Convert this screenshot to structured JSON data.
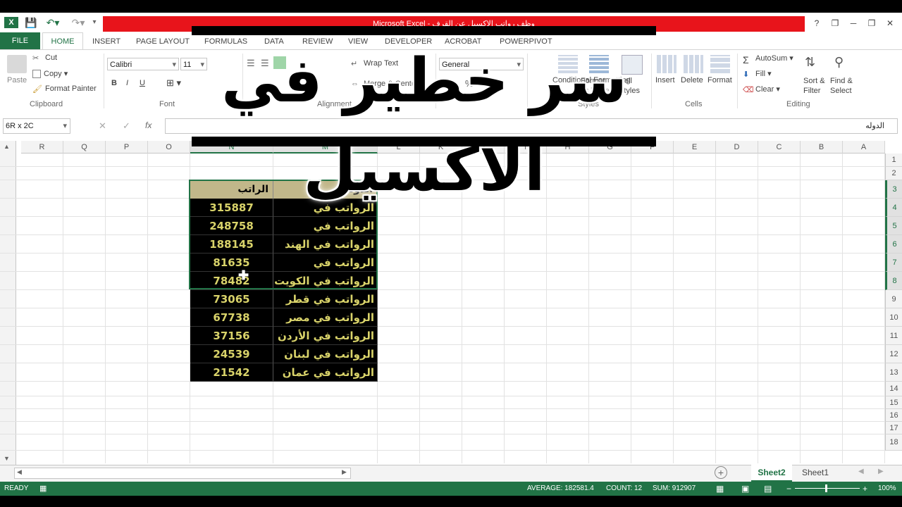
{
  "window": {
    "title": "Microsoft Excel - وظف رواتب الاكسيل عن القرف",
    "controls": [
      "?",
      "❐",
      "─",
      "❐",
      "✕"
    ]
  },
  "ribbon_tabs": [
    "FILE",
    "HOME",
    "INSERT",
    "PAGE LAYOUT",
    "FORMULAS",
    "DATA",
    "REVIEW",
    "VIEW",
    "DEVELOPER",
    "ACROBAT",
    "POWERPIVOT"
  ],
  "clipboard": {
    "paste": "Paste",
    "cut": "Cut",
    "copy": "Copy",
    "format_painter": "Format Painter",
    "label": "Clipboard"
  },
  "font": {
    "name": "Calibri",
    "size": "11",
    "bold": "B",
    "italic": "I",
    "underline": "U",
    "label": "Font"
  },
  "alignment": {
    "wrap_text": "Wrap Text",
    "merge_center": "Merge & Center",
    "label": "Alignment"
  },
  "number": {
    "format": "General",
    "currency": "$",
    "percent": "%"
  },
  "styles": {
    "conditional": "Conditional Formatting",
    "format_as_table": "Format as Table",
    "cell_styles": "Cell Styles",
    "label": "Styles"
  },
  "cells": {
    "insert": "Insert",
    "delete": "Delete",
    "format": "Format",
    "label": "Cells"
  },
  "editing": {
    "autosum": "AutoSum",
    "fill": "Fill",
    "clear": "Clear",
    "sort_filter": "Sort & Filter",
    "find_select": "Find & Select",
    "label": "Editing"
  },
  "formula_bar": {
    "name_box": "6R x 2C",
    "fx": "fx",
    "content": "الدوله"
  },
  "columns": [
    "R",
    "Q",
    "P",
    "O",
    "N",
    "M",
    "L",
    "K",
    "J",
    "I",
    "H",
    "G",
    "F",
    "E",
    "D",
    "C",
    "B",
    "A"
  ],
  "rows": [
    "1",
    "2",
    "3",
    "4",
    "5",
    "6",
    "7",
    "8",
    "9",
    "10",
    "11",
    "12",
    "13",
    "14",
    "15",
    "16",
    "17",
    "18"
  ],
  "table": {
    "headers": {
      "country": "الدوله",
      "salary": "الراتب"
    },
    "rows": [
      {
        "country": "الرواتب في الإمارات",
        "salary": "315887"
      },
      {
        "country": "الرواتب في السعودية",
        "salary": "248758"
      },
      {
        "country": "الرواتب في الهند",
        "salary": "188145"
      },
      {
        "country": "الرواتب في باكستان",
        "salary": "81635"
      },
      {
        "country": "الرواتب في الكويت",
        "salary": "78482"
      },
      {
        "country": "الرواتب في قطر",
        "salary": "73065"
      },
      {
        "country": "الرواتب في مصر",
        "salary": "67738"
      },
      {
        "country": "الرواتب في الأردن",
        "salary": "37156"
      },
      {
        "country": "الرواتب في لبنان",
        "salary": "24539"
      },
      {
        "country": "الرواتب في عمان",
        "salary": "21542"
      }
    ]
  },
  "overlay_title": "سر خطير في الاكسيل",
  "sheets": {
    "active": "Sheet2",
    "other": "Sheet1"
  },
  "status": {
    "ready": "READY",
    "average": "AVERAGE: 182581.4",
    "count": "COUNT: 12",
    "sum": "SUM: 912907",
    "zoom": "100%"
  },
  "colors": {
    "excel_green": "#217346",
    "title_red": "#e8141b",
    "header_tan": "#c1b78a",
    "data_yellow": "#d9d36a"
  }
}
